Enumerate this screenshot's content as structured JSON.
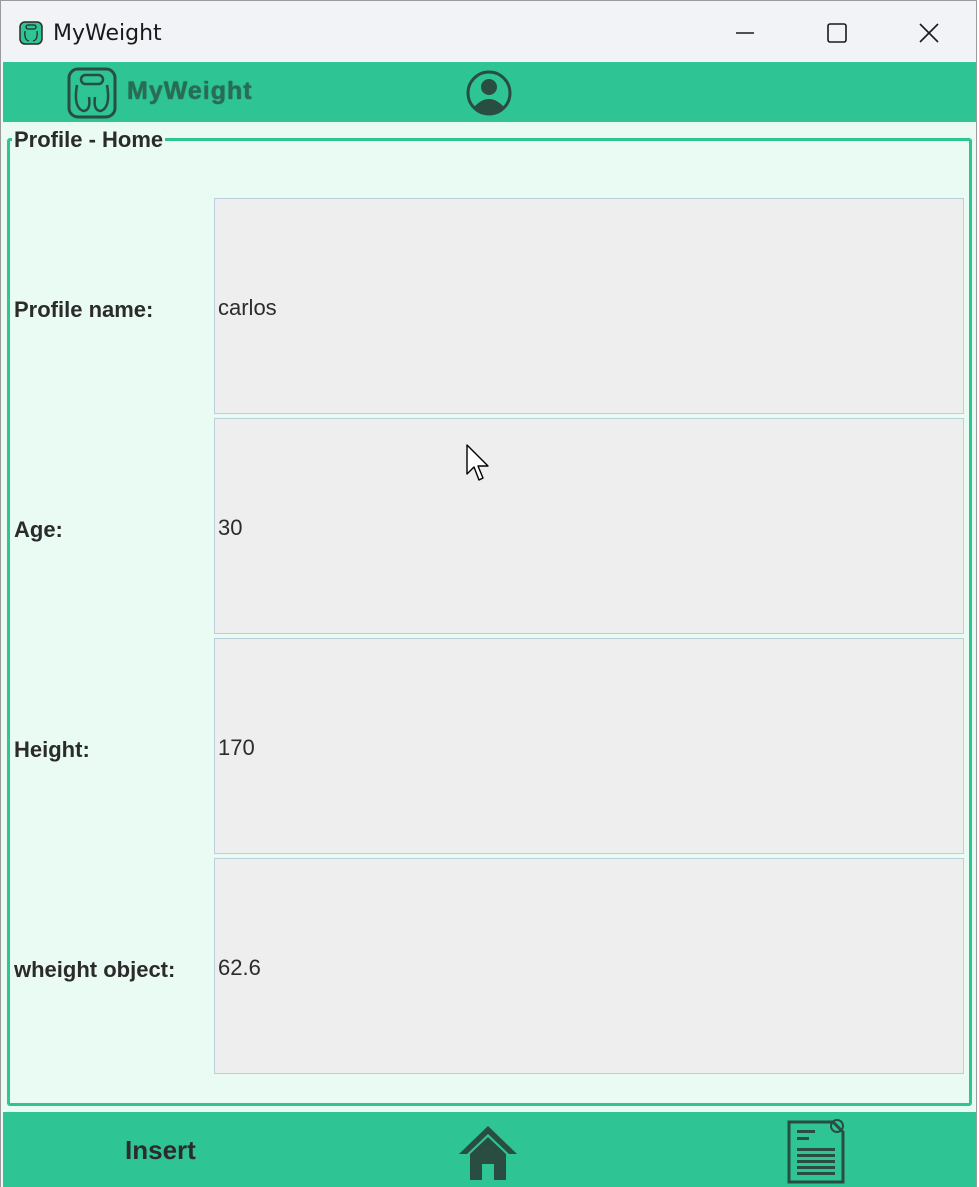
{
  "window": {
    "title": "MyWeight",
    "icons": {
      "app": "scale-icon",
      "minimize": "minimize-icon",
      "maximize": "maximize-icon",
      "close": "close-icon"
    }
  },
  "header": {
    "logo_text": "MyWeight",
    "icons": {
      "logo": "scale-icon",
      "profile": "user-circle-icon"
    },
    "accent_color": "#2ec493"
  },
  "panel": {
    "legend": "Profile - Home",
    "rows": [
      {
        "label": "Profile name:",
        "value": "carlos"
      },
      {
        "label": "Age:",
        "value": "30"
      },
      {
        "label": "Height:",
        "value": "170"
      },
      {
        "label": "wheight object:",
        "value": "62.6"
      }
    ]
  },
  "footer": {
    "insert_label": "Insert",
    "icons": {
      "home": "home-icon",
      "report": "document-icon"
    }
  }
}
